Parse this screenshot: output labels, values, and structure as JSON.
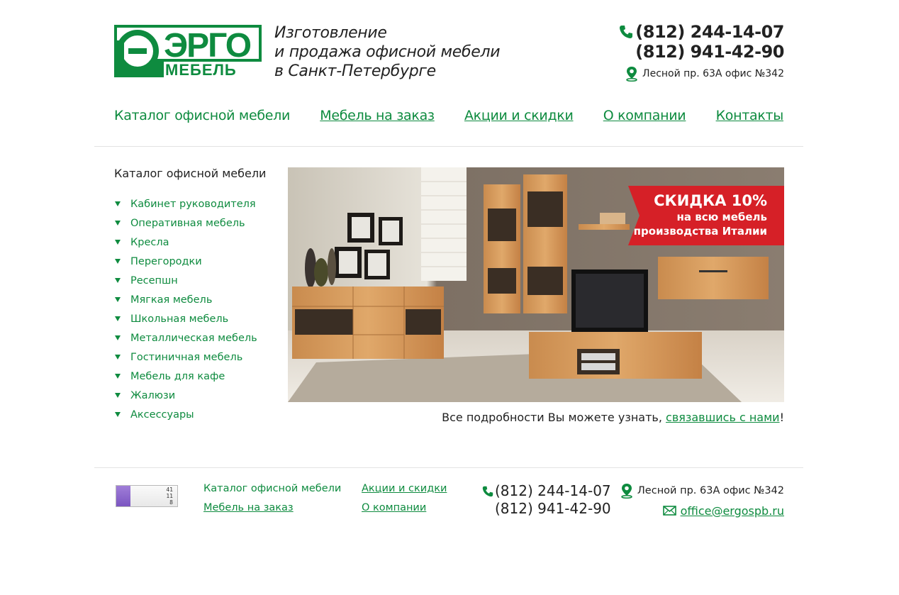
{
  "brand": {
    "logo_text": "ЭРГО",
    "logo_sub": "МЕБЕЛЬ",
    "green": "#0e8b3f"
  },
  "header": {
    "tagline": [
      "Изготовление",
      "и продажа офисной мебели",
      "в Санкт-Петербурге"
    ],
    "phone1": "(812) 244-14-07",
    "phone2": "(812) 941-42-90",
    "address": "Лесной пр. 63А офис №342"
  },
  "nav": {
    "items": [
      {
        "label": "Каталог офисной мебели"
      },
      {
        "label": "Мебель на заказ"
      },
      {
        "label": "Акции и скидки"
      },
      {
        "label": "О компании"
      },
      {
        "label": "Контакты"
      }
    ]
  },
  "sidebar": {
    "title": "Каталог офисной мебели",
    "items": [
      {
        "label": "Кабинет руководителя"
      },
      {
        "label": "Оперативная мебель"
      },
      {
        "label": "Кресла"
      },
      {
        "label": "Перегородки"
      },
      {
        "label": "Ресепшн"
      },
      {
        "label": "Мягкая мебель"
      },
      {
        "label": "Школьная мебель"
      },
      {
        "label": "Металлическая мебель"
      },
      {
        "label": "Гостиничная мебель"
      },
      {
        "label": "Мебель для кафе"
      },
      {
        "label": "Жалюзи"
      },
      {
        "label": "Аксессуары"
      }
    ]
  },
  "banner": {
    "promo_title": "СКИДКА 10%",
    "promo_line1": "на всю мебель",
    "promo_line2": "производства Италии",
    "promo_color": "#d62027"
  },
  "details": {
    "text": "Все подробности Вы можете узнать, ",
    "link": "связавшись с нами",
    "end": "!"
  },
  "footer": {
    "counter": {
      "line1": "41",
      "line2": "11",
      "line3": "8"
    },
    "links_col1": [
      "Каталог офисной мебели",
      "Мебель на заказ"
    ],
    "links_col2": [
      "Акции и скидки",
      "О компании"
    ],
    "phone1": "(812) 244-14-07",
    "phone2": "(812) 941-42-90",
    "address": "Лесной пр. 63А офис №342",
    "email": "office@ergospb.ru"
  }
}
